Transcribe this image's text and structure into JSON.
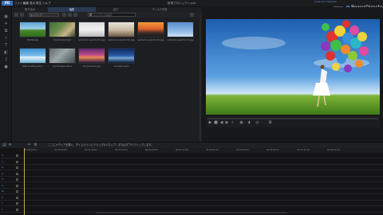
{
  "titlebar": {
    "logo": "PD",
    "menus": [
      "ファイル",
      "編集",
      "表示",
      "再生",
      "ヘルプ"
    ],
    "document_title": "新規プロジェクト.pds",
    "account": "CyberLink Member",
    "brand": "PowerDirector",
    "back_button": "戻る"
  },
  "tabs": [
    {
      "label": "取り込み"
    },
    {
      "label": "編集"
    },
    {
      "label": "出力"
    },
    {
      "label": "ディスク作成"
    }
  ],
  "library": {
    "filter_label": "全メディア",
    "search_placeholder": "ライブラリの検索",
    "items": [
      {
        "caption": "Fields.jpg",
        "icon": "field-photo"
      },
      {
        "caption": "Food.Kiss.mp4",
        "icon": "video-clip"
      },
      {
        "caption": "extreme sports 01.jpg",
        "icon": "bike-photo"
      },
      {
        "caption": "extreme sports 02.jpg",
        "icon": "dirtbike-photo"
      },
      {
        "caption": "extreme sports 03.jpg",
        "icon": "sunset-photo"
      },
      {
        "caption": "extreme sports 04.jpg",
        "icon": "skydive-photo"
      },
      {
        "caption": "Kite Surfing.wmv",
        "icon": "kite-video"
      },
      {
        "caption": "Landscape.wmv",
        "icon": "landscape-video"
      },
      {
        "caption": "Sunrise 01.jpg",
        "icon": "sunrise-photo"
      },
      {
        "caption": "Sunset.mp4",
        "icon": "sunset-video"
      }
    ]
  },
  "timeline": {
    "hint": "ここにメディアを挿入、タイムラインにドラッグ&ドロップ、またはダブルクリックします。",
    "ruler_ticks": [
      "00:00:00:00",
      "00:00:50:00",
      "00:01:40:02",
      "00:02:30:04",
      "00:03:20:06",
      "00:04:10:08",
      "00:05:00:10",
      "00:05:50:12",
      "00:06:40:14",
      "00:07:30:16",
      "00:08:20:18"
    ],
    "tracks": [
      "1.",
      "1.",
      "2.",
      "2.",
      "3.",
      "3.",
      "fx",
      "T",
      "♪",
      "♪"
    ]
  },
  "colors": {
    "accent": "#3a72c4",
    "playhead": "#c8a24a"
  }
}
